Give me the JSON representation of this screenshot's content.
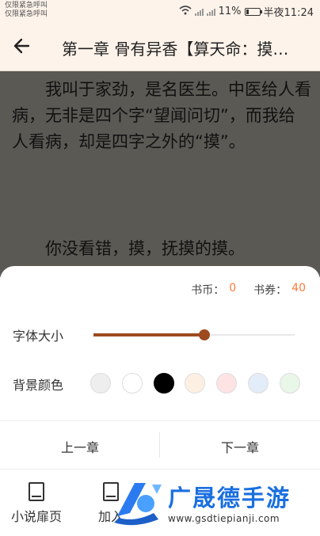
{
  "status_bar": {
    "carrier_line1": "仅限紧急呼叫",
    "carrier_line2": "仅限紧急呼叫",
    "battery": "11%",
    "time": "半夜11:24"
  },
  "header": {
    "title": "第一章 骨有异香【算天命：摸…"
  },
  "reading": {
    "paragraph1": "我叫于家劲，是名医生。中医给人看病，无非是四个字“望闻问切”，而我给人看病，却是四字之外的“摸”。",
    "paragraph2": "你没看错，摸，抚摸的摸。"
  },
  "settings": {
    "coins_label": "书币：",
    "coins_value": "0",
    "vouchers_label": "书券：",
    "vouchers_value": "40",
    "font_size_label": "字体大小",
    "font_size_level": 0.55,
    "background_label": "背景颜色",
    "background_colors": [
      "#eeeeee",
      "#ffffff",
      "#000000",
      "#fdf0e3",
      "#fde3e3",
      "#e3edf9",
      "#e8f7e8"
    ],
    "selected_background": 2,
    "prev_chapter": "上一章",
    "next_chapter": "下一章"
  },
  "bottom_nav": {
    "items": [
      {
        "label": "小说扉页"
      },
      {
        "label": "加入"
      }
    ]
  },
  "watermark": {
    "brand": "广晟德手游",
    "url": "www.gsdtiepianji.com"
  },
  "colors": {
    "accent": "#9d4a1f",
    "price": "#ff7a3a",
    "header_bg": "#fdf3ea",
    "reading_bg": "#5a5954"
  }
}
